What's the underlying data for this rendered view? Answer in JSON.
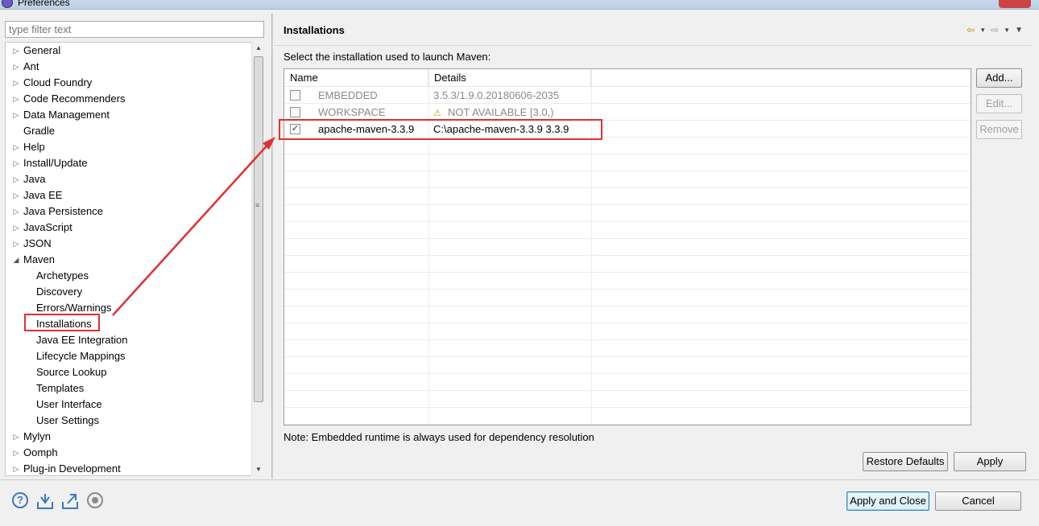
{
  "window": {
    "title": "Preferences"
  },
  "filter": {
    "placeholder": "type filter text"
  },
  "tree": [
    {
      "label": "General",
      "twisty": "▷",
      "level": 0
    },
    {
      "label": "Ant",
      "twisty": "▷",
      "level": 0
    },
    {
      "label": "Cloud Foundry",
      "twisty": "▷",
      "level": 0
    },
    {
      "label": "Code Recommenders",
      "twisty": "▷",
      "level": 0
    },
    {
      "label": "Data Management",
      "twisty": "▷",
      "level": 0
    },
    {
      "label": "Gradle",
      "twisty": "",
      "level": 0
    },
    {
      "label": "Help",
      "twisty": "▷",
      "level": 0
    },
    {
      "label": "Install/Update",
      "twisty": "▷",
      "level": 0
    },
    {
      "label": "Java",
      "twisty": "▷",
      "level": 0
    },
    {
      "label": "Java EE",
      "twisty": "▷",
      "level": 0
    },
    {
      "label": "Java Persistence",
      "twisty": "▷",
      "level": 0
    },
    {
      "label": "JavaScript",
      "twisty": "▷",
      "level": 0
    },
    {
      "label": "JSON",
      "twisty": "▷",
      "level": 0
    },
    {
      "label": "Maven",
      "twisty": "◢",
      "level": 0
    },
    {
      "label": "Archetypes",
      "twisty": "",
      "level": 1
    },
    {
      "label": "Discovery",
      "twisty": "",
      "level": 1
    },
    {
      "label": "Errors/Warnings",
      "twisty": "",
      "level": 1
    },
    {
      "label": "Installations",
      "twisty": "",
      "level": 1,
      "selected": true
    },
    {
      "label": "Java EE Integration",
      "twisty": "",
      "level": 1
    },
    {
      "label": "Lifecycle Mappings",
      "twisty": "",
      "level": 1
    },
    {
      "label": "Source Lookup",
      "twisty": "",
      "level": 1
    },
    {
      "label": "Templates",
      "twisty": "",
      "level": 1
    },
    {
      "label": "User Interface",
      "twisty": "",
      "level": 1
    },
    {
      "label": "User Settings",
      "twisty": "",
      "level": 1
    },
    {
      "label": "Mylyn",
      "twisty": "▷",
      "level": 0
    },
    {
      "label": "Oomph",
      "twisty": "▷",
      "level": 0
    },
    {
      "label": "Plug-in Development",
      "twisty": "▷",
      "level": 0
    }
  ],
  "page": {
    "title": "Installations",
    "instruction": "Select the installation used to launch Maven:",
    "columns": {
      "name": "Name",
      "details": "Details"
    },
    "rows": [
      {
        "name": "EMBEDDED",
        "details": "3.5.3/1.9.0.20180606-2035",
        "checked": false,
        "disabled": true,
        "warning": false
      },
      {
        "name": "WORKSPACE",
        "details": "NOT AVAILABLE [3.0,)",
        "checked": false,
        "disabled": true,
        "warning": true
      },
      {
        "name": "apache-maven-3.3.9",
        "details": "C:\\apache-maven-3.3.9 3.3.9",
        "checked": true,
        "disabled": false,
        "warning": false
      }
    ],
    "side_buttons": {
      "add": "Add...",
      "edit": "Edit...",
      "remove": "Remove"
    },
    "note": "Note: Embedded runtime is always used for dependency resolution",
    "restore_defaults": "Restore Defaults",
    "apply": "Apply"
  },
  "footer": {
    "apply_and_close": "Apply and Close",
    "cancel": "Cancel",
    "icons": [
      "help-icon",
      "import-icon",
      "export-icon",
      "record-icon"
    ]
  },
  "colors": {
    "annotation": "#e03030",
    "default_button_border": "#3c7fb1"
  }
}
